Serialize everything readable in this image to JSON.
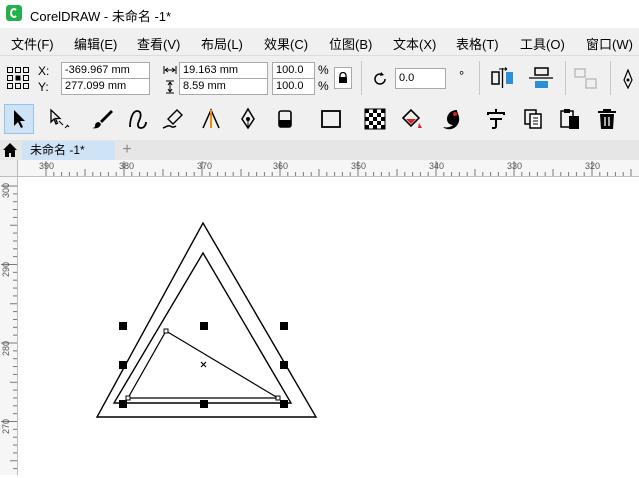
{
  "window": {
    "title": "CorelDRAW - 未命名 -1*"
  },
  "menu": [
    "文件(F)",
    "编辑(E)",
    "查看(V)",
    "布局(L)",
    "效果(C)",
    "位图(B)",
    "文本(X)",
    "表格(T)",
    "工具(O)",
    "窗口(W)"
  ],
  "property_bar": {
    "x_label": "X:",
    "y_label": "Y:",
    "x_value": "-369.967 mm",
    "y_value": "277.099 mm",
    "width_value": "19.163 mm",
    "height_value": "8.59 mm",
    "scale_x": "100.0",
    "scale_y": "100.0",
    "percent": "%",
    "rotation_value": "0.0",
    "degree_symbol": "°"
  },
  "document_tab": {
    "label": "未命名 -1*",
    "add_symbol": "+"
  },
  "ruler": {
    "horizontal_labels": [
      "390",
      "380",
      "370",
      "360",
      "350",
      "340",
      "330",
      "320"
    ],
    "vertical_labels": [
      "300",
      "290",
      "280",
      "270"
    ]
  },
  "icons": [
    "app-logo",
    "pick-tool",
    "shape-tool",
    "artistic-media",
    "freehand-curve",
    "calligraphy",
    "dimension",
    "pen",
    "eraser",
    "rectangle",
    "transparency-checker",
    "fill-bucket",
    "smart-fill",
    "text-tool",
    "copy-tool",
    "paste-tool",
    "delete-tool",
    "home-icon",
    "lock-icon",
    "rotate-icon"
  ],
  "colors": {
    "selection_accent": "#cfe3f7",
    "highlight_red": "#e02020",
    "highlight_orange": "#f28c00",
    "highlight_blue": "#2b8fd6"
  }
}
